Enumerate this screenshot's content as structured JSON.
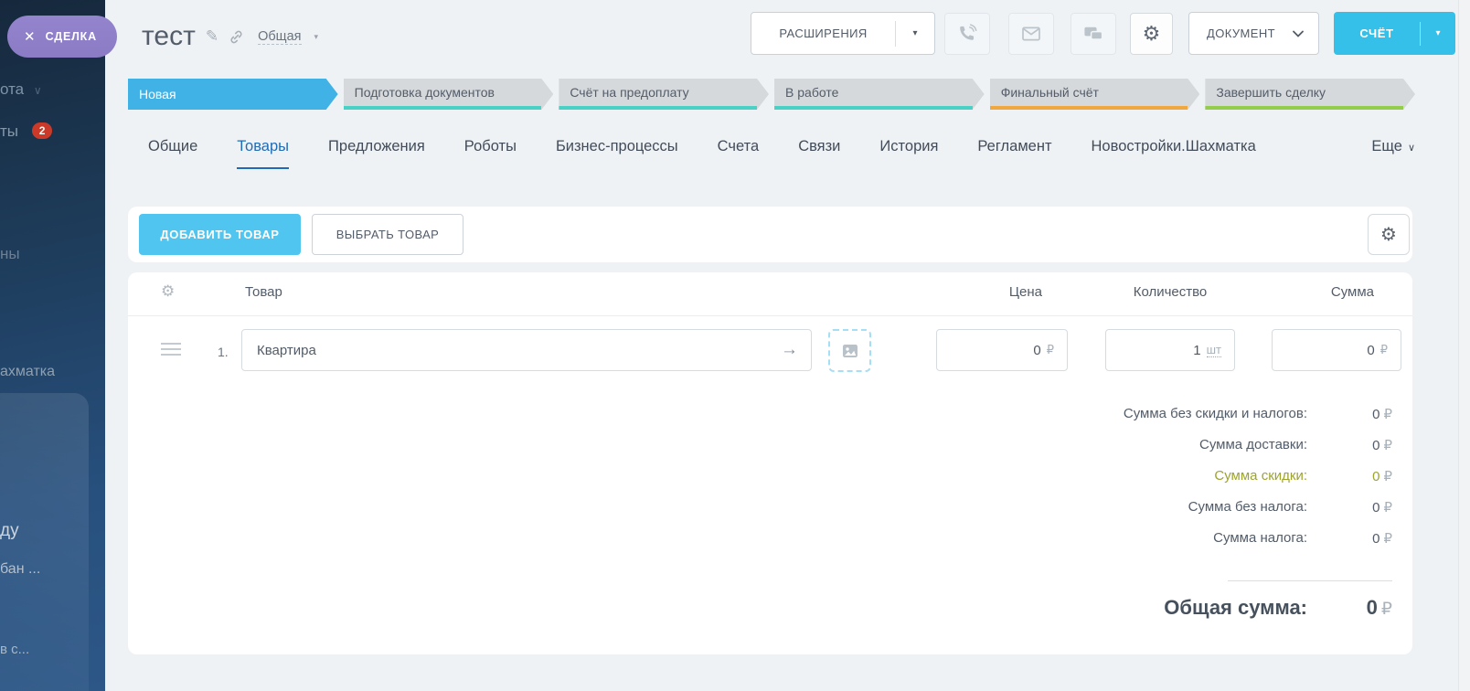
{
  "slider": {
    "close_label": "СДЕЛКА",
    "close_icon": "✕"
  },
  "sidebar": {
    "fragments": [
      {
        "label": "ота",
        "caret": "∨"
      },
      {
        "label": "ты",
        "badge": "2"
      },
      {
        "label": "ны"
      },
      {
        "label": "ахматка"
      },
      {
        "label": "ду"
      },
      {
        "label": "бан ..."
      },
      {
        "label": "в с..."
      }
    ]
  },
  "header": {
    "title": "тест",
    "category": "Общая",
    "extensions_button": "РАСШИРЕНИЯ",
    "document_button": "ДОКУМЕНТ",
    "invoice_button": "СЧЁТ",
    "icons": [
      "phone-icon",
      "mail-icon",
      "chat-icon",
      "gear-icon"
    ]
  },
  "stages": [
    {
      "label": "Новая",
      "active": true,
      "color": "#41b2e5"
    },
    {
      "label": "Подготовка документов",
      "underline": "#4ad1c5"
    },
    {
      "label": "Счёт на предоплату",
      "underline": "#4ad1c5"
    },
    {
      "label": "В работе",
      "underline": "#4ad1c5"
    },
    {
      "label": "Финальный счёт",
      "underline": "#f0a73e"
    },
    {
      "label": "Завершить сделку",
      "underline": "#94cd4a"
    }
  ],
  "tabs": [
    {
      "label": "Общие"
    },
    {
      "label": "Товары",
      "active": true
    },
    {
      "label": "Предложения"
    },
    {
      "label": "Роботы"
    },
    {
      "label": "Бизнес-процессы"
    },
    {
      "label": "Счета"
    },
    {
      "label": "Связи"
    },
    {
      "label": "История"
    },
    {
      "label": "Регламент"
    },
    {
      "label": "Новостройки.Шахматка"
    },
    {
      "label": "Еще",
      "caret": "∨"
    }
  ],
  "toolbar": {
    "add_product": "ДОБАВИТЬ ТОВАР",
    "select_product": "ВЫБРАТЬ ТОВАР"
  },
  "products": {
    "columns": {
      "product": "Товар",
      "price": "Цена",
      "quantity": "Количество",
      "sum": "Сумма"
    },
    "rows": [
      {
        "index": "1.",
        "name": "Квартира",
        "price": "0",
        "price_unit": "₽",
        "quantity": "1",
        "quantity_unit": "шт",
        "sum": "0",
        "sum_unit": "₽"
      }
    ]
  },
  "totals": {
    "rows": [
      {
        "label": "Сумма без скидки и налогов:",
        "value": "0",
        "unit": "₽"
      },
      {
        "label": "Сумма доставки:",
        "value": "0",
        "unit": "₽"
      },
      {
        "label": "Сумма скидки:",
        "value": "0",
        "unit": "₽",
        "highlight": true
      },
      {
        "label": "Сумма без налога:",
        "value": "0",
        "unit": "₽"
      },
      {
        "label": "Сумма налога:",
        "value": "0",
        "unit": "₽"
      }
    ],
    "grand_label": "Общая сумма:",
    "grand_value": "0",
    "grand_unit": "₽"
  },
  "colors": {
    "accent_blue": "#35c0ea",
    "light_blue_button": "#50c5ef",
    "active_stage": "#41b2e5",
    "stage_teal": "#4ad1c5",
    "stage_orange": "#f0a73e",
    "stage_green": "#94cd4a",
    "active_tab": "#1e6bb8",
    "discount_olive": "#9da32f",
    "close_pill_purple": "#8e7ec8",
    "badge_red": "#cb3a28",
    "sidebar_navy": "#1d3a57"
  }
}
